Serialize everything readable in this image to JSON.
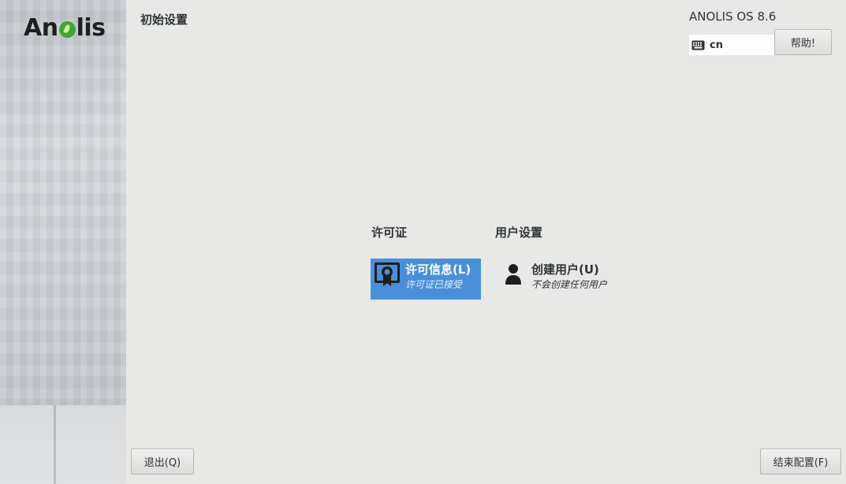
{
  "sidebar": {
    "logo_text": "Anolis",
    "logo_prefix": "An",
    "logo_suffix": "lis"
  },
  "header": {
    "title": "初始设置",
    "product": "ANOLIS OS 8.6",
    "keyboard_layout": "cn",
    "help_label": "帮助!"
  },
  "hub": {
    "categories": [
      {
        "title": "许可证",
        "spokes": [
          {
            "title": "许可信息(L)",
            "status": "许可证已接受",
            "icon": "license-icon",
            "selected": true
          }
        ]
      },
      {
        "title": "用户设置",
        "spokes": [
          {
            "title": "创建用户(U)",
            "status": "不会创建任何用户",
            "icon": "user-icon",
            "selected": false
          }
        ]
      }
    ]
  },
  "footer": {
    "quit_label": "退出(Q)",
    "finish_label": "结束配置(F)"
  },
  "colors": {
    "accent": "#4a90d9",
    "background": "#e8e8e7",
    "logo_leaf": "#41a336"
  }
}
